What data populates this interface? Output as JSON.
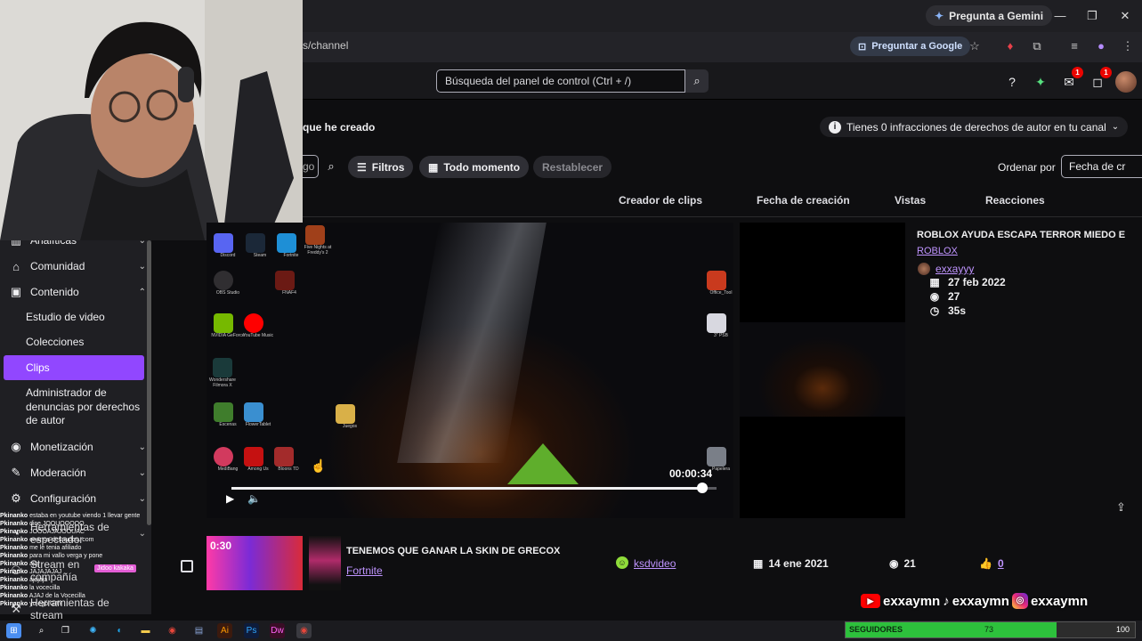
{
  "browser": {
    "gemini_label": "Pregunta a Gemini",
    "url": "s/channel",
    "ask_google_label": "Preguntar a Google",
    "window_controls": [
      "minimize-icon",
      "restore-icon",
      "close-icon"
    ]
  },
  "topnav": {
    "search_placeholder": "Búsqueda del panel de control (Ctrl + /)",
    "notifications": {
      "inbox_count": "1",
      "whispers_count": "1"
    }
  },
  "header": {
    "title_fragment": "que he creado",
    "copyright_notice": "Tienes 0 infracciones de derechos de autor en tu canal"
  },
  "filters": {
    "search_value": "go",
    "filters_label": "Filtros",
    "time_label": "Todo momento",
    "reset_label": "Restablecer",
    "sort_label": "Ordenar por",
    "sort_value": "Fecha de cr"
  },
  "table": {
    "columns": [
      "Creador de clips",
      "Fecha de creación",
      "Vistas",
      "Reacciones"
    ]
  },
  "sidebar": {
    "items": [
      {
        "label": "Analíticas",
        "icon": "analytics-icon"
      },
      {
        "label": "Comunidad",
        "icon": "community-icon"
      },
      {
        "label": "Contenido",
        "icon": "content-icon"
      },
      {
        "label": "Monetización",
        "icon": "monetization-icon"
      },
      {
        "label": "Moderación",
        "icon": "moderation-icon"
      },
      {
        "label": "Configuración",
        "icon": "settings-icon"
      },
      {
        "label": "Herramientas de espectador",
        "icon": "viewer-tools-icon"
      },
      {
        "label": "Stream en compañía",
        "icon": "stream-together-icon"
      },
      {
        "label": "Herramientas de stream",
        "icon": "stream-tools-icon"
      }
    ],
    "content_sub": [
      "Estudio de video",
      "Colecciones",
      "Clips",
      "Administrador de denuncias por derechos de autor"
    ]
  },
  "clip_preview": {
    "timestamp": "00:00:34",
    "progress": 0.97,
    "desktop_icons": [
      "Discord",
      "Steam",
      "Fortnite",
      "Five Nights at Freddy's 2",
      "OBS Studio",
      "FNAF4",
      "NVIDIA GeForce",
      "YouTube Music",
      "Wondershare Filmora X",
      "Escenas",
      "FlowerTablet",
      "Juegos",
      "MediBang",
      "Among Us",
      "Bloons TD",
      "Office_Tool",
      "3\" PSB",
      "Papelera"
    ]
  },
  "clip_detail": {
    "title": "ROBLOX AYUDA ESCAPA TERROR MIEDO E",
    "game": "ROBLOX",
    "creator": "exxayyy",
    "date": "27 feb 2022",
    "views": "27",
    "duration": "35s"
  },
  "rows": [
    {
      "duration": "0:30",
      "title": "TENEMOS QUE GANAR LA SKIN DE GRECOX",
      "game": "Fortnite",
      "creator": "ksdvideo",
      "date": "14 ene 2021",
      "views": "21",
      "reactions": "0"
    }
  ],
  "chat": [
    {
      "user": "Pkinanko",
      "text": "estaba en youtube viendo 1 llevar gente"
    },
    {
      "user": "Pkinanko",
      "text": "dice JOOUOOOOO"
    },
    {
      "user": "Pkinanko",
      "text": "JOOOAJAJOOUAC"
    },
    {
      "user": "Pkinanko",
      "text": "enanos desnudos. com"
    },
    {
      "user": "Pkinanko",
      "text": "me le tenia afiliado"
    },
    {
      "user": "Pkinanko",
      "text": "para mi vallo verga y pone"
    },
    {
      "user": "Pkinanko",
      "text": "ajaj"
    },
    {
      "user": "Pkinanko",
      "text": "JAJAJAJAJ"
    },
    {
      "user": "Pkinanko",
      "text": "ajajaja"
    },
    {
      "user": "Pkinanko",
      "text": "la vocecilla"
    },
    {
      "user": "Pkinanko",
      "text": "AJAJ de la Vocecilla"
    },
    {
      "user": "Pkinanko",
      "text": "yo ego GAY"
    }
  ],
  "chat_tag": "Jidoo kakaka",
  "socials": {
    "youtube": "exxaymn",
    "tiktok": "exxaymn",
    "instagram": "exxaymn"
  },
  "followers_goal": {
    "label": "SEGUIDORES",
    "current": "73",
    "goal": "100",
    "fraction": 0.73
  },
  "colors": {
    "accent": "#9147ff",
    "link": "#bf94ff",
    "goal_fill": "#2dc13c"
  }
}
